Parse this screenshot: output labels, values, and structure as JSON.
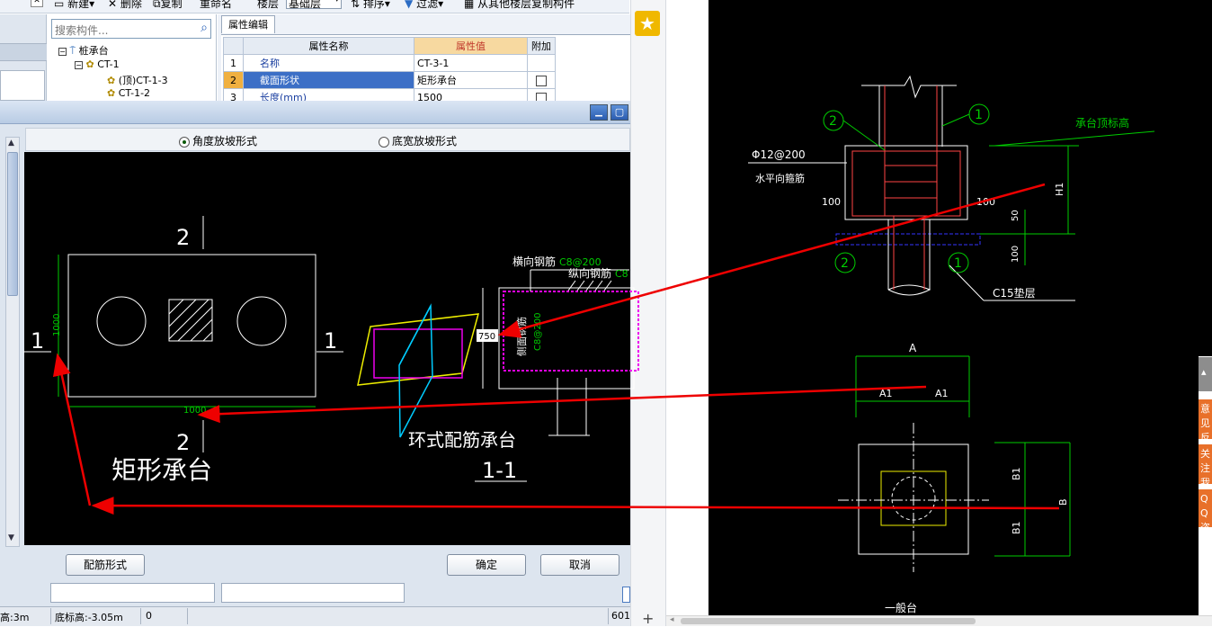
{
  "toolbar": {
    "new": "新建",
    "delete": "删除",
    "copy": "复制",
    "rename": "重命名",
    "floor": "楼层",
    "layer_value": "基础层",
    "sort": "排序",
    "filter": "过滤",
    "copy_from": "从其他楼层复制构件"
  },
  "search": {
    "placeholder": "搜索构件..."
  },
  "tree": {
    "root": "桩承台",
    "group": "CT-1",
    "children": [
      "(顶)CT-1-3",
      "CT-1-2"
    ]
  },
  "props": {
    "tab": "属性编辑",
    "headers": [
      "属性名称",
      "属性值",
      "附加"
    ],
    "rows": [
      {
        "num": "1",
        "name": "名称",
        "value": "CT-3-1"
      },
      {
        "num": "2",
        "name": "截面形状",
        "value": "矩形承台"
      },
      {
        "num": "3",
        "name": "长度(mm)",
        "value": "1500"
      }
    ]
  },
  "dialog": {
    "option1": "角度放坡形式",
    "option2": "底宽放坡形式",
    "selected": "角度放坡形式",
    "rebar_button": "配筋形式",
    "ok_button": "确定",
    "cancel_button": "取消"
  },
  "cad_left": {
    "dim_top": "2",
    "dim_bottom": "2",
    "dim_left": "1",
    "dim_right": "1",
    "height_dim": "1000",
    "width_dim": "1000",
    "caption": "矩形承台",
    "horizontal_rebar": "横向钢筋",
    "horizontal_rebar_value": "C8@200",
    "longitudinal_rebar": "纵向钢筋",
    "longitudinal_rebar_value": "C8",
    "side_rebar": "侧面钢筋",
    "side_rebar_value": "C8@200",
    "dim_750": "750",
    "ring_caption": "环式配筋承台",
    "section_caption": "1-1"
  },
  "cad_right": {
    "rebar_spec": "Φ12@200",
    "rebar_note": "水平向箍筋",
    "marker1": "1",
    "marker2": "2",
    "dim_100_left": "100",
    "dim_100_right": "100",
    "dim_50": "50",
    "dim_100_low": "100",
    "h1": "H1",
    "cap_elevation": "承台顶标高",
    "cushion": "C15垫层",
    "dim_a": "A",
    "dim_a1_left": "A1",
    "dim_a1_right": "A1",
    "dim_b": "B",
    "dim_b1_top": "B1",
    "dim_b1_bottom": "B1",
    "caption": "一般台"
  },
  "status": {
    "height": "高:3m",
    "bottom_elev": "底标高:-3.05m",
    "value": "0",
    "coord": "601"
  },
  "side_tabs": [
    "意见反馈",
    "关注我们",
    "QQ咨询"
  ]
}
